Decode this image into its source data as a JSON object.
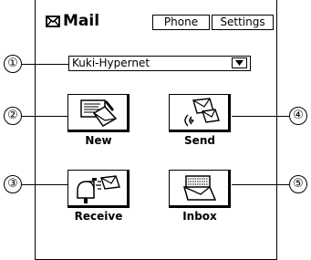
{
  "header": {
    "title": "Mail",
    "title_icon": "envelope-icon",
    "phone_button": "Phone",
    "settings_button": "Settings"
  },
  "account_select": {
    "value": "Kuki-Hypernet",
    "icon": "dropdown-arrow-icon"
  },
  "apps": [
    {
      "label": "New",
      "icon": "new-mail-icon"
    },
    {
      "label": "Send",
      "icon": "send-mail-icon"
    },
    {
      "label": "Receive",
      "icon": "receive-mail-icon"
    },
    {
      "label": "Inbox",
      "icon": "inbox-icon"
    }
  ],
  "callouts": [
    "①",
    "②",
    "③",
    "④",
    "⑤"
  ]
}
